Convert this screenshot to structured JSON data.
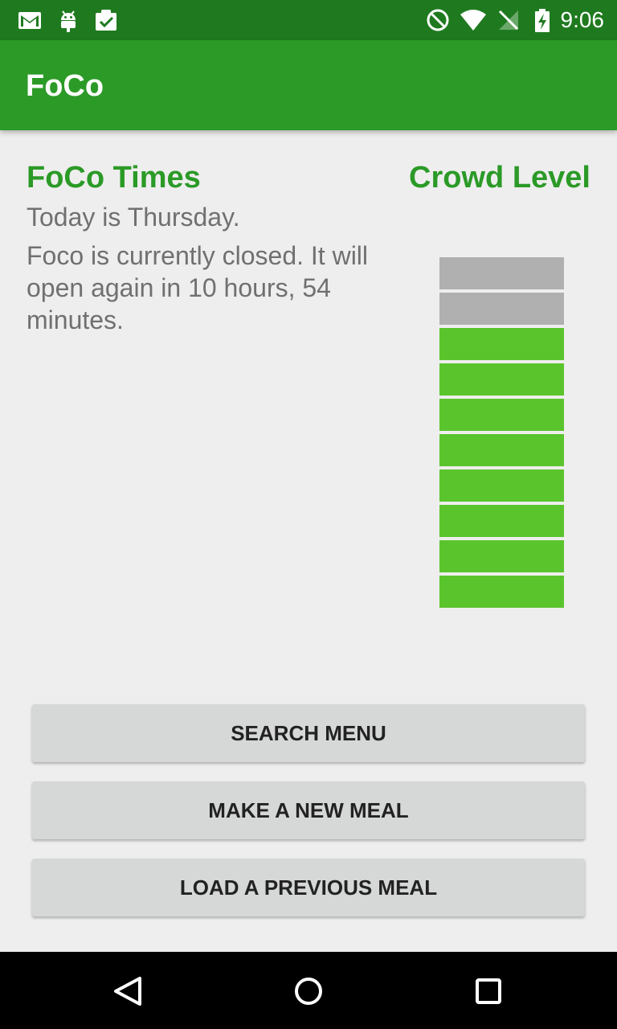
{
  "status_bar": {
    "time": "9:06",
    "left_icons": [
      "gmail-icon",
      "android-icon",
      "clipboard-check-icon"
    ],
    "right_icons": [
      "do-not-disturb-icon",
      "wifi-icon",
      "no-sim-icon",
      "battery-charging-icon"
    ]
  },
  "app_bar": {
    "title": "FoCo"
  },
  "main": {
    "times_heading": "FoCo Times",
    "crowd_heading": "Crowd Level",
    "today_text": "Today is Thursday.",
    "status_text": "Foco is currently closed.  It will open again in 10 hours, 54 minutes.",
    "crowd_level": {
      "filled_segments": 8,
      "total_segments": 10
    },
    "colors": {
      "accent": "#2b9a27",
      "crowd_on": "#5ac42d",
      "crowd_off": "#b0b0b0"
    }
  },
  "buttons": {
    "search_menu": "SEARCH MENU",
    "make_meal": "MAKE A NEW MEAL",
    "load_meal": "LOAD A PREVIOUS MEAL"
  },
  "nav_bar": {
    "icons": [
      "back-icon",
      "home-icon",
      "recents-icon"
    ]
  }
}
